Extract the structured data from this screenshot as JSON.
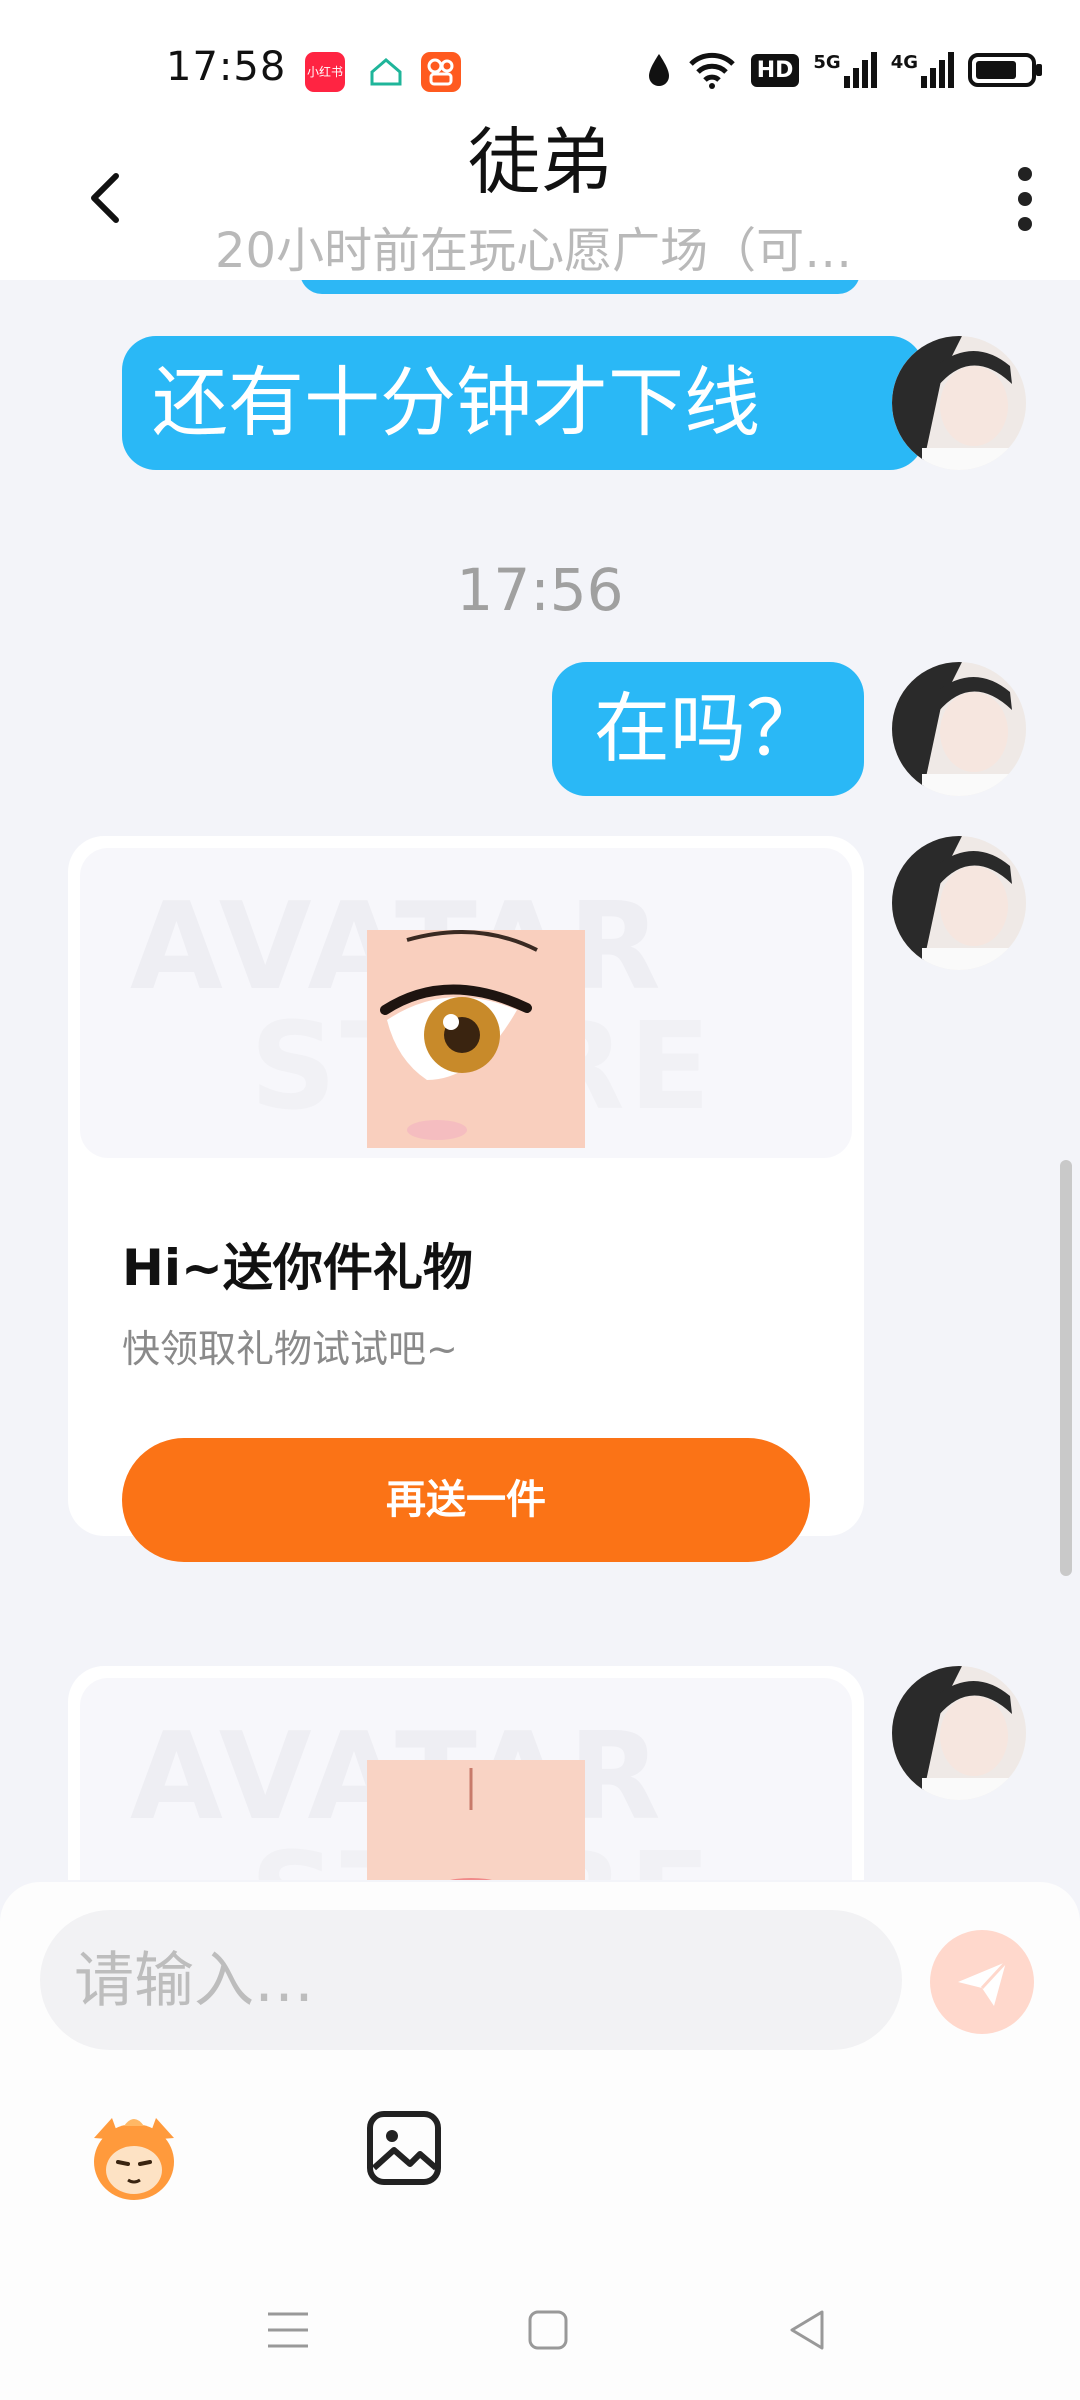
{
  "status_bar": {
    "time": "17:58",
    "apps": [
      "小红书",
      "home-app",
      "kuaishou-app"
    ],
    "icons": [
      "water-drop-icon",
      "wifi-icon",
      "hd-icon",
      "signal-5g-icon",
      "signal-4g-icon",
      "battery-icon"
    ],
    "badge_hd": "HD",
    "badge_5g": "5G",
    "badge_4g": "4G"
  },
  "header": {
    "title": "徒弟",
    "subtitle": "20小时前在玩心愿广场（可…"
  },
  "messages": {
    "msg1": "还有十分钟才下线",
    "timestamp": "17:56",
    "msg2": "在吗？"
  },
  "gift_card": {
    "watermark_line1": "AVATAR",
    "watermark_line2": "STORE",
    "title": "Hi~送你件礼物",
    "description": "快领取礼物试试吧~",
    "button_label": "再送一件"
  },
  "input": {
    "placeholder": "请输入…"
  },
  "colors": {
    "accent_blue": "#2ab8f6",
    "accent_orange": "#fb7316",
    "send_button": "#ffd8cc"
  }
}
